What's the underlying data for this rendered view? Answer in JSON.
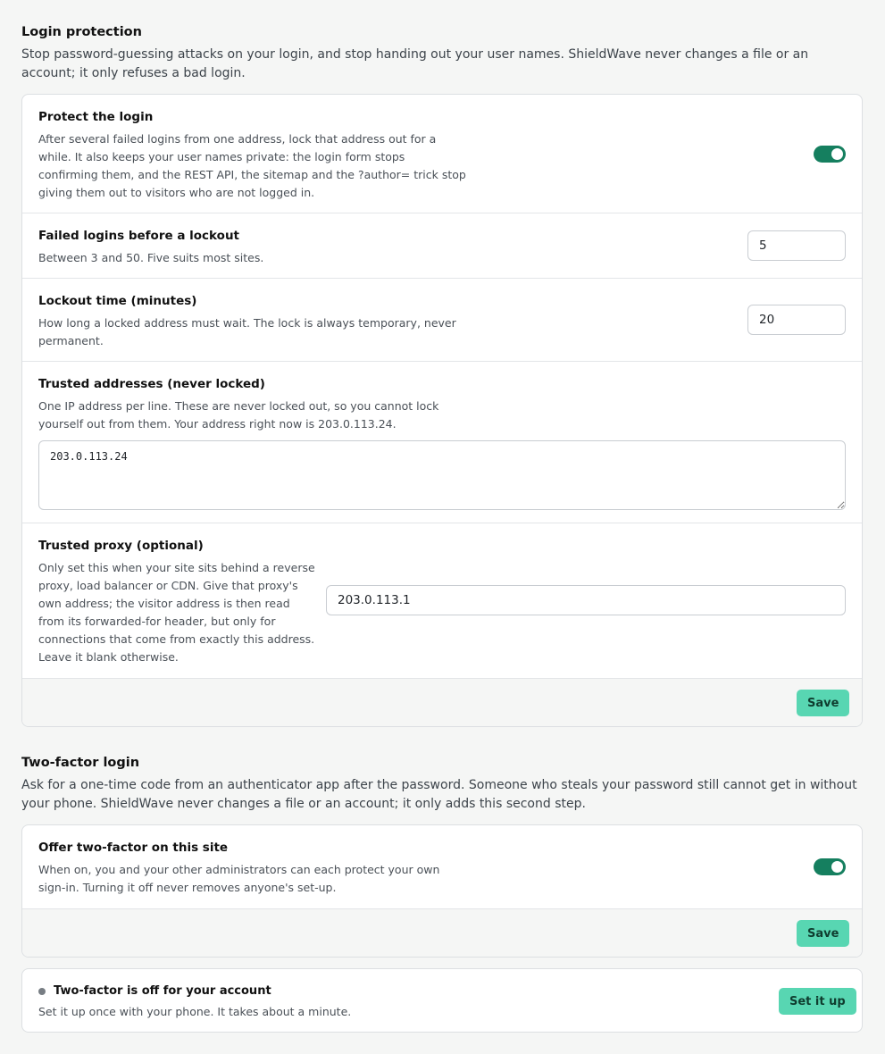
{
  "login_protection": {
    "title": "Login protection",
    "description": "Stop password-guessing attacks on your login, and stop handing out your user names. ShieldWave never changes a file or an account; it only refuses a bad login.",
    "protect": {
      "title": "Protect the login",
      "description": "After several failed logins from one address, lock that address out for a while. It also keeps your user names private: the login form stops confirming them, and the REST API, the sitemap and the ?author= trick stop giving them out to visitors who are not logged in.",
      "enabled": true
    },
    "failed_logins": {
      "title": "Failed logins before a lockout",
      "description": "Between 3 and 50. Five suits most sites.",
      "value": "5"
    },
    "lockout_time": {
      "title": "Lockout time (minutes)",
      "description": "How long a locked address must wait. The lock is always temporary, never permanent.",
      "value": "20"
    },
    "trusted_addresses": {
      "title": "Trusted addresses (never locked)",
      "description": "One IP address per line. These are never locked out, so you cannot lock yourself out from them. Your address right now is 203.0.113.24.",
      "value": "203.0.113.24"
    },
    "trusted_proxy": {
      "title": "Trusted proxy (optional)",
      "description": "Only set this when your site sits behind a reverse proxy, load balancer or CDN. Give that proxy's own address; the visitor address is then read from its forwarded-for header, but only for connections that come from exactly this address. Leave it blank otherwise.",
      "value": "203.0.113.1"
    },
    "save_label": "Save"
  },
  "two_factor": {
    "title": "Two-factor login",
    "description": "Ask for a one-time code from an authenticator app after the password. Someone who steals your password still cannot get in without your phone. ShieldWave never changes a file or an account; it only adds this second step.",
    "offer": {
      "title": "Offer two-factor on this site",
      "description": "When on, you and your other administrators can each protect your own sign-in. Turning it off never removes anyone's set-up.",
      "enabled": true
    },
    "save_label": "Save",
    "account": {
      "status": "Two-factor is off for your account",
      "description": "Set it up once with your phone. It takes about a minute.",
      "setup_label": "Set it up"
    }
  },
  "colors": {
    "accent": "#157f5f",
    "button": "#58d6b2",
    "status_off": "#777d83"
  }
}
